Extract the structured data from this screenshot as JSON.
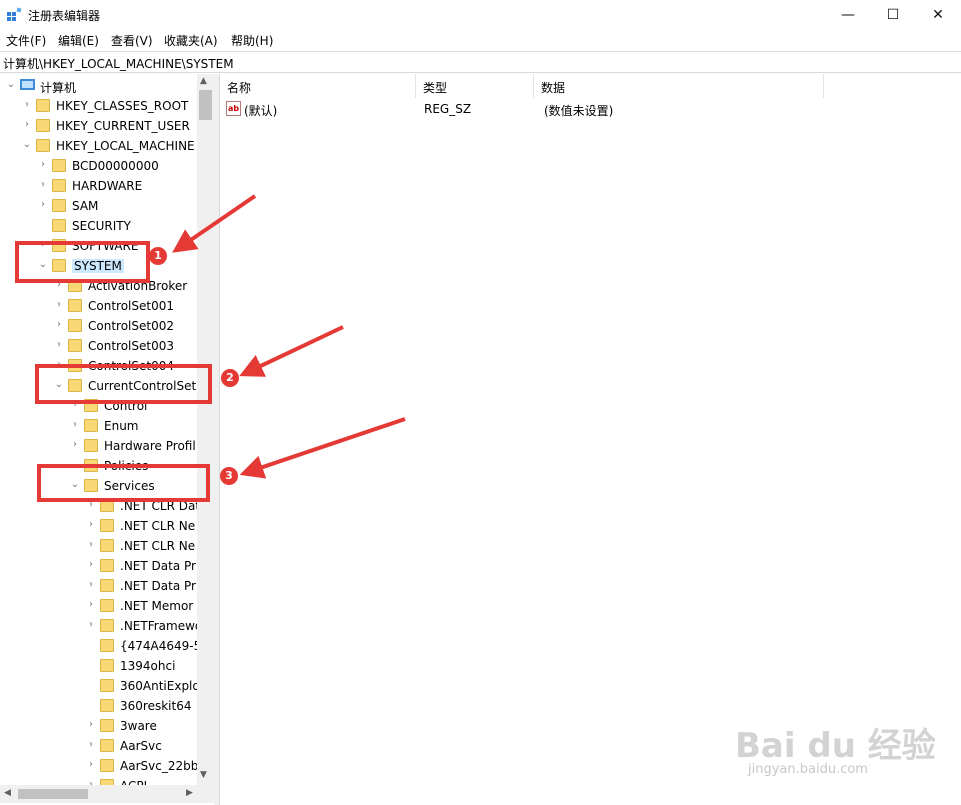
{
  "window": {
    "title": "注册表编辑器",
    "min_glyph": "—",
    "max_glyph": "☐",
    "close_glyph": "✕"
  },
  "menu": [
    "文件(F)",
    "编辑(E)",
    "查看(V)",
    "收藏夹(A)",
    "帮助(H)"
  ],
  "address": "计算机\\HKEY_LOCAL_MACHINE\\SYSTEM",
  "tree": [
    {
      "label": "计算机",
      "icon": "computer-icon",
      "expander": "expanded"
    },
    {
      "label": "HKEY_CLASSES_ROOT",
      "expander": "collapsed"
    },
    {
      "label": "HKEY_CURRENT_USER",
      "expander": "collapsed"
    },
    {
      "label": "HKEY_LOCAL_MACHINE",
      "expander": "expanded"
    },
    {
      "label": "BCD00000000",
      "expander": "collapsed"
    },
    {
      "label": "HARDWARE",
      "expander": "collapsed"
    },
    {
      "label": "SAM",
      "expander": "collapsed"
    },
    {
      "label": "SECURITY",
      "expander": "none"
    },
    {
      "label": "SOFTWARE",
      "expander": "collapsed"
    },
    {
      "label": "SYSTEM",
      "expander": "expanded",
      "selected": true
    },
    {
      "label": "ActivationBroker",
      "expander": "collapsed"
    },
    {
      "label": "ControlSet001",
      "expander": "collapsed"
    },
    {
      "label": "ControlSet002",
      "expander": "collapsed"
    },
    {
      "label": "ControlSet003",
      "expander": "collapsed"
    },
    {
      "label": "ControlSet004",
      "expander": "collapsed"
    },
    {
      "label": "CurrentControlSet",
      "expander": "expanded"
    },
    {
      "label": "Control",
      "expander": "collapsed"
    },
    {
      "label": "Enum",
      "expander": "collapsed"
    },
    {
      "label": "Hardware Profil",
      "expander": "collapsed"
    },
    {
      "label": "Policies",
      "expander": "none"
    },
    {
      "label": "Services",
      "expander": "expanded"
    },
    {
      "label": ".NET CLR Dat",
      "expander": "collapsed"
    },
    {
      "label": ".NET CLR Ne",
      "expander": "collapsed"
    },
    {
      "label": ".NET CLR Ne",
      "expander": "collapsed"
    },
    {
      "label": ".NET Data Pr",
      "expander": "collapsed"
    },
    {
      "label": ".NET Data Pr",
      "expander": "collapsed"
    },
    {
      "label": ".NET Memor",
      "expander": "collapsed"
    },
    {
      "label": ".NETFramewo",
      "expander": "collapsed"
    },
    {
      "label": "{474A4649-5",
      "expander": "none"
    },
    {
      "label": "1394ohci",
      "expander": "none"
    },
    {
      "label": "360AntiExplo",
      "expander": "none"
    },
    {
      "label": "360reskit64",
      "expander": "none"
    },
    {
      "label": "3ware",
      "expander": "collapsed"
    },
    {
      "label": "AarSvc",
      "expander": "collapsed"
    },
    {
      "label": "AarSvc_22bb",
      "expander": "collapsed"
    },
    {
      "label": "ACPI",
      "expander": "collapsed"
    }
  ],
  "list": {
    "columns": [
      "名称",
      "类型",
      "数据"
    ],
    "rows": [
      {
        "name": "(默认)",
        "type": "REG_SZ",
        "data": "(数值未设置)",
        "icon_text": "ab"
      }
    ]
  },
  "annotations": [
    "1",
    "2",
    "3"
  ],
  "watermark": {
    "main": "Bai du 经验",
    "sub": "jingyan.baidu.com"
  },
  "colors": {
    "highlight": "#e53935",
    "folder": "#f8d775",
    "selection": "#cce8ff"
  }
}
